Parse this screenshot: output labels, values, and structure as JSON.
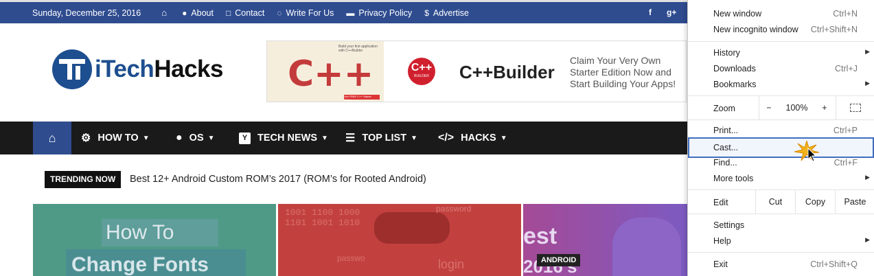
{
  "topbar": {
    "date": "Sunday, December 25, 2016",
    "links": [
      {
        "label": "About",
        "icon": "user-icon"
      },
      {
        "label": "Contact",
        "icon": "square-icon"
      },
      {
        "label": "Write For Us",
        "icon": "whatsapp-icon"
      },
      {
        "label": "Privacy Policy",
        "icon": "briefcase-icon"
      },
      {
        "label": "Advertise",
        "icon": "dollar-icon"
      }
    ],
    "social": [
      "f",
      "g+"
    ]
  },
  "logo": {
    "part1": "iTech",
    "part2": "Hacks"
  },
  "ad": {
    "art_text": "C++",
    "art_small": "Build your first application with C++Builder",
    "art_button": "Get FREE C++ Starter Edition",
    "badge_main": "C++",
    "badge_sub": "BUILDER",
    "title": "C++Builder",
    "copy": "Claim Your Very Own Starter Edition Now and Start Building Your Apps!"
  },
  "nav": {
    "items": [
      {
        "label": "HOW TO",
        "icon": "gears-icon"
      },
      {
        "label": "OS",
        "icon": "apple-icon"
      },
      {
        "label": "TECH NEWS",
        "icon": "y-icon"
      },
      {
        "label": "TOP LIST",
        "icon": "list-icon"
      },
      {
        "label": "HACKS",
        "icon": "code-icon"
      }
    ]
  },
  "trending": {
    "badge": "TRENDING NOW",
    "text": "Best 12+ Android Custom ROM’s 2017 (ROM’s for Rooted Android)"
  },
  "cards": {
    "card1_line1": "How To",
    "card1_line2": "Change Fonts",
    "card2_binary": "1001 1100 1000\n1101 1001 1010",
    "card2_pw1": "password",
    "card2_pw2": "passwo",
    "card2_login": "login",
    "card3_best": "est",
    "card3_year": "2016's",
    "card3_badge": "ANDROID"
  },
  "menu": {
    "new_window": {
      "label": "New window",
      "shortcut": "Ctrl+N"
    },
    "new_incognito": {
      "label": "New incognito window",
      "shortcut": "Ctrl+Shift+N"
    },
    "history": {
      "label": "History"
    },
    "downloads": {
      "label": "Downloads",
      "shortcut": "Ctrl+J"
    },
    "bookmarks": {
      "label": "Bookmarks"
    },
    "zoom": {
      "label": "Zoom",
      "minus": "−",
      "value": "100%",
      "plus": "+"
    },
    "print": {
      "label": "Print...",
      "shortcut": "Ctrl+P"
    },
    "cast": {
      "label": "Cast..."
    },
    "find": {
      "label": "Find...",
      "shortcut": "Ctrl+F"
    },
    "more_tools": {
      "label": "More tools"
    },
    "edit": {
      "label": "Edit",
      "cut": "Cut",
      "copy": "Copy",
      "paste": "Paste"
    },
    "settings": {
      "label": "Settings"
    },
    "help": {
      "label": "Help"
    },
    "exit": {
      "label": "Exit",
      "shortcut": "Ctrl+Shift+Q"
    }
  },
  "colors": {
    "brand_blue": "#2f4c8f",
    "nav_black": "#1a1a1a",
    "menu_highlight": "#3f6dbf"
  }
}
